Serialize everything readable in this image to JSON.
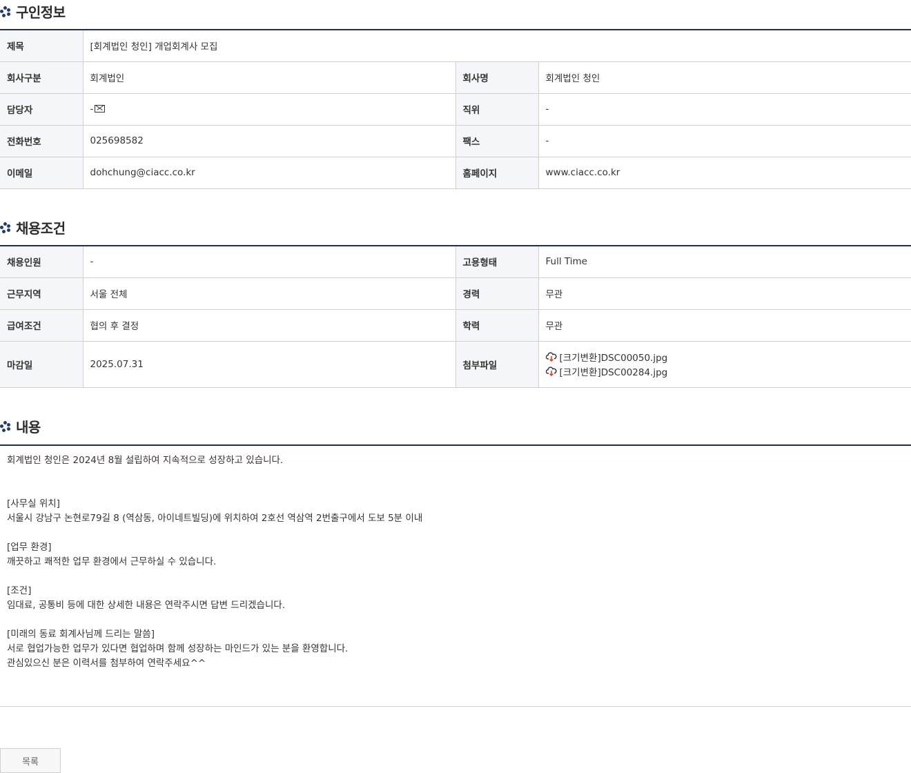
{
  "sections": {
    "job_info": {
      "title": "구인정보",
      "labels": {
        "subject": "제목",
        "company_type": "회사구분",
        "company_name": "회사명",
        "contact": "담당자",
        "position": "직위",
        "phone": "전화번호",
        "fax": "팩스",
        "email": "이메일",
        "homepage": "홈페이지"
      },
      "values": {
        "subject": "[회계법인 청인] 개업회계사 모집",
        "company_type": "회계법인",
        "company_name": "회계법인 청인",
        "contact": "-",
        "position": "-",
        "phone": "025698582",
        "fax": "-",
        "email": "dohchung@ciacc.co.kr",
        "homepage": "www.ciacc.co.kr"
      }
    },
    "conditions": {
      "title": "채용조건",
      "labels": {
        "headcount": "채용인원",
        "employment_type": "고용형태",
        "work_area": "근무지역",
        "experience": "경력",
        "salary": "급여조건",
        "education": "학력",
        "deadline": "마감일",
        "attachments": "첨부파일"
      },
      "values": {
        "headcount": "-",
        "employment_type": "Full Time",
        "work_area": "서울 전체",
        "experience": "무관",
        "salary": "협의 후 결정",
        "education": "무관",
        "deadline": "2025.07.31",
        "attachments": [
          "[크기변환]DSC00050.jpg",
          "[크기변환]DSC00284.jpg"
        ]
      }
    },
    "content": {
      "title": "내용",
      "lines": [
        "회계법인 청인은 2024년 8월 설립하여 지속적으로 성장하고 있습니다.",
        "",
        "",
        "[사무실 위치]",
        "서울시 강남구 논현로79길 8 (역삼동, 아이네트빌딩)에 위치하여 2호선 역삼역 2번출구에서 도보 5분 이내",
        "",
        "[업무 환경]",
        "깨끗하고 쾌적한 업무 환경에서 근무하실 수 있습니다.",
        "",
        "[조건]",
        "임대료, 공통비 등에 대한 상세한 내용은 연락주시면 답변 드리겠습니다.",
        "",
        "[미래의 동료 회계사님께 드리는 말씀]",
        "서로 협업가능한 업무가 있다면 협업하며 함께 성장하는 마인드가 있는 분을 환영합니다.",
        "관심있으신 분은 이력서를 첨부하여 연락주세요^^"
      ]
    }
  },
  "buttons": {
    "list": "목록"
  },
  "icons": {
    "section_bullet": "dots-icon",
    "contact_mail": "mail-icon",
    "attachment": "cloud-download-icon"
  }
}
